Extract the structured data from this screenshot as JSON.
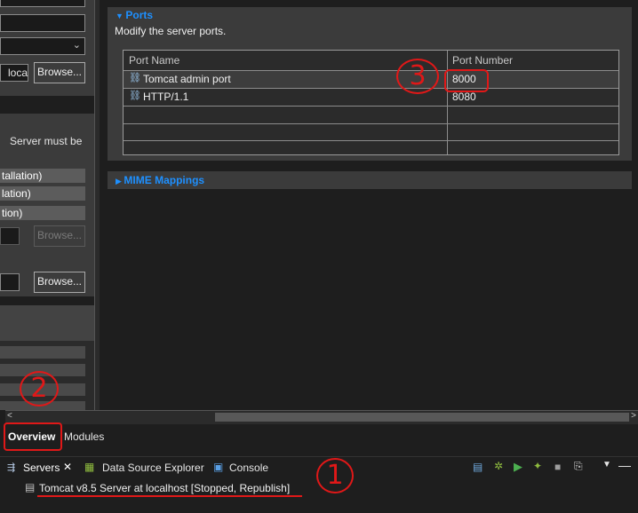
{
  "left_panel": {
    "location_value": "loca",
    "browse_label": "Browse...",
    "server_note": "Server must be",
    "options": [
      "tallation)",
      "lation)",
      "tion)"
    ],
    "browse_disabled_label": "Browse...",
    "browse3_label": "Browse..."
  },
  "ports_section": {
    "title": "Ports",
    "description": "Modify the server ports.",
    "columns": [
      "Port Name",
      "Port Number"
    ],
    "rows": [
      {
        "name": "Tomcat admin port",
        "number": "8000"
      },
      {
        "name": "HTTP/1.1",
        "number": "8080"
      }
    ]
  },
  "mime_section": {
    "title": "MIME Mappings"
  },
  "editor_tabs": [
    "Overview",
    "Modules"
  ],
  "views": {
    "servers_label": "Servers",
    "datasource_label": "Data Source Explorer",
    "console_label": "Console"
  },
  "server_entry": "Tomcat v8.5 Server at localhost  [Stopped, Republish]",
  "annotations": {
    "one": "1",
    "two": "2",
    "three": "3"
  },
  "colors": {
    "section_title": "#1e90ff",
    "annotation": "#e01818"
  }
}
